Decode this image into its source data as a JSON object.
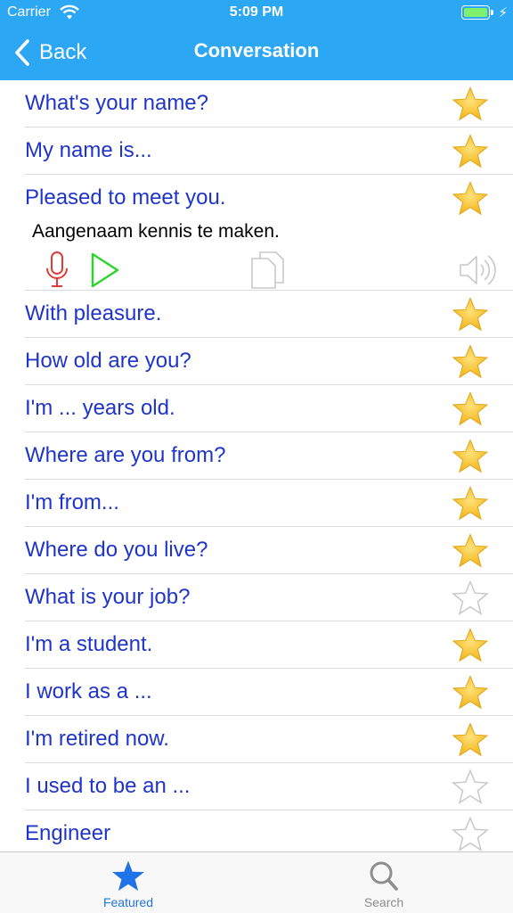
{
  "status_bar": {
    "carrier": "Carrier",
    "time": "5:09 PM"
  },
  "nav": {
    "back_label": "Back",
    "title": "Conversation"
  },
  "colors": {
    "accent": "#2ca7f4",
    "link_text": "#1f35c9",
    "star_filled": "#f6c325",
    "tab_active": "#1f73e8"
  },
  "phrases": [
    {
      "text": "What's your name?",
      "favorite": true
    },
    {
      "text": "My name is...",
      "favorite": true
    },
    {
      "text": "Pleased to meet you.",
      "favorite": true,
      "translation": "Aangenaam kennis te maken."
    },
    {
      "text": "With pleasure.",
      "favorite": true
    },
    {
      "text": "How old are you?",
      "favorite": true
    },
    {
      "text": "I'm ... years old.",
      "favorite": true
    },
    {
      "text": "Where are you from?",
      "favorite": true
    },
    {
      "text": "I'm from...",
      "favorite": true
    },
    {
      "text": "Where do you live?",
      "favorite": true
    },
    {
      "text": "What is your job?",
      "favorite": false
    },
    {
      "text": "I'm a student.",
      "favorite": true
    },
    {
      "text": "I work as a ...",
      "favorite": true
    },
    {
      "text": "I'm retired now.",
      "favorite": true
    },
    {
      "text": "I used to be an ...",
      "favorite": false
    },
    {
      "text": "Engineer",
      "favorite": false
    }
  ],
  "tools": {
    "icons": [
      "microphone-icon",
      "play-icon",
      "copy-icon",
      "speaker-icon"
    ]
  },
  "tabbar": {
    "tabs": [
      {
        "label": "Featured",
        "icon": "star-icon",
        "active": true
      },
      {
        "label": "Search",
        "icon": "search-icon",
        "active": false
      }
    ]
  }
}
